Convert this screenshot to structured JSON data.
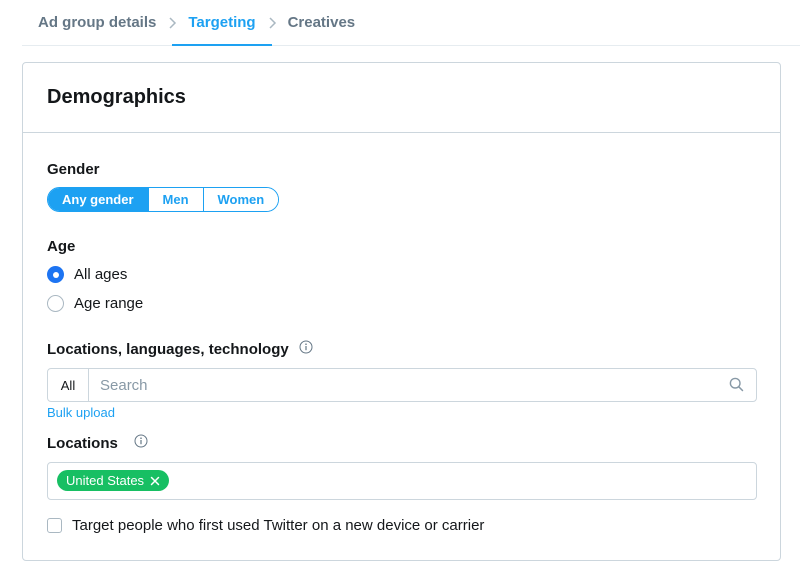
{
  "breadcrumb": {
    "steps": [
      {
        "label": "Ad group details",
        "active": false
      },
      {
        "label": "Targeting",
        "active": true
      },
      {
        "label": "Creatives",
        "active": false
      }
    ]
  },
  "card": {
    "title": "Demographics"
  },
  "gender": {
    "label": "Gender",
    "options": [
      "Any gender",
      "Men",
      "Women"
    ],
    "selected": "Any gender"
  },
  "age": {
    "label": "Age",
    "options": [
      {
        "label": "All ages",
        "checked": true
      },
      {
        "label": "Age range",
        "checked": false
      }
    ]
  },
  "llt": {
    "label": "Locations, languages, technology",
    "info_icon": "info-icon",
    "prefix": "All",
    "search_placeholder": "Search",
    "search_icon": "search-icon",
    "bulk_upload": "Bulk upload"
  },
  "locations": {
    "label": "Locations",
    "info_icon": "info-icon",
    "tags": [
      {
        "label": "United States",
        "remove_icon": "close-icon"
      }
    ]
  },
  "new_device": {
    "label": "Target people who first used Twitter on a new device or carrier",
    "checked": false
  },
  "colors": {
    "accent": "#1da1f2",
    "radio_checked": "#1d74f2",
    "tag": "#17bf63",
    "border": "#ccd6dd",
    "muted": "#657786"
  }
}
